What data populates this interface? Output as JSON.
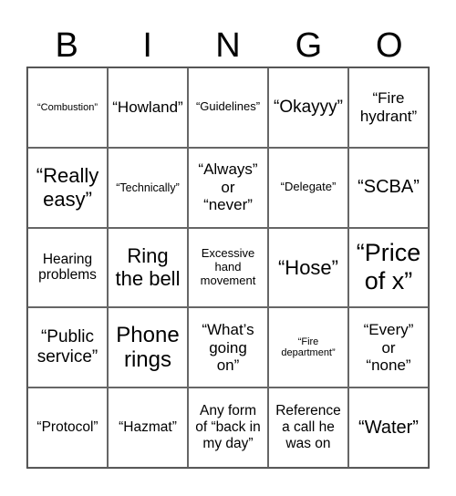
{
  "header": [
    "B",
    "I",
    "N",
    "G",
    "O"
  ],
  "cells": [
    "“Combustion”",
    "“Howland”",
    "“Guidelines”",
    "“Okayyy”",
    "“Fire\nhydrant”",
    "“Really\neasy”",
    "“Technically”",
    "“Always”\nor\n“never”",
    "“Delegate”",
    "“SCBA”",
    "Hearing\nproblems",
    "Ring\nthe bell",
    "Excessive\nhand\nmovement",
    "“Hose”",
    "“Price\nof x”",
    "“Public\nservice”",
    "Phone\nrings",
    "“What’s\ngoing\non”",
    "“Fire\ndepartment”",
    "“Every”\nor\n“none”",
    "“Protocol”",
    "“Hazmat”",
    "Any form\nof “back in\nmy day”",
    "Reference\na call he\nwas on",
    "“Water”"
  ]
}
